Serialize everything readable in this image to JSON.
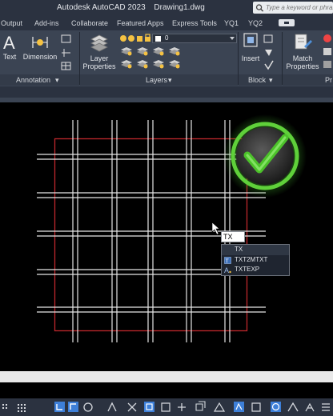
{
  "app": {
    "name": "Autodesk AutoCAD 2023",
    "file": "Drawing1.dwg"
  },
  "search": {
    "placeholder": "Type a keyword or phrase"
  },
  "tabs": [
    {
      "label": "Output"
    },
    {
      "label": "Add-ins"
    },
    {
      "label": "Collaborate"
    },
    {
      "label": "Featured Apps"
    },
    {
      "label": "Express Tools"
    },
    {
      "label": "YQ1"
    },
    {
      "label": "YQ2"
    }
  ],
  "ribbon": {
    "annotation": {
      "text_label": "Text",
      "dimension_label": "Dimension",
      "panel_label": "Annotation"
    },
    "layers": {
      "properties_label_1": "Layer",
      "properties_label_2": "Properties",
      "current_layer": "0",
      "panel_label": "Layers"
    },
    "block": {
      "insert_label": "Insert",
      "panel_label": "Block"
    },
    "properties": {
      "match_label_1": "Match",
      "match_label_2": "Properties",
      "panel_label_partial": "Pr"
    }
  },
  "command": {
    "input_value": "TX",
    "suggestions": [
      {
        "label": "TX",
        "icon": "blank-icon",
        "selected": true
      },
      {
        "label": "TXT2MTXT",
        "icon": "text-convert-icon",
        "selected": false
      },
      {
        "label": "TXTEXP",
        "icon": "text-explode-icon",
        "selected": false
      }
    ]
  },
  "colors": {
    "titlebar": "#2b3240",
    "ribbon": "#3b4453",
    "canvas": "#000000",
    "boundary": "#c0272d",
    "grid_lines": "#e6e6e6",
    "check_green": "#4cc22a"
  }
}
